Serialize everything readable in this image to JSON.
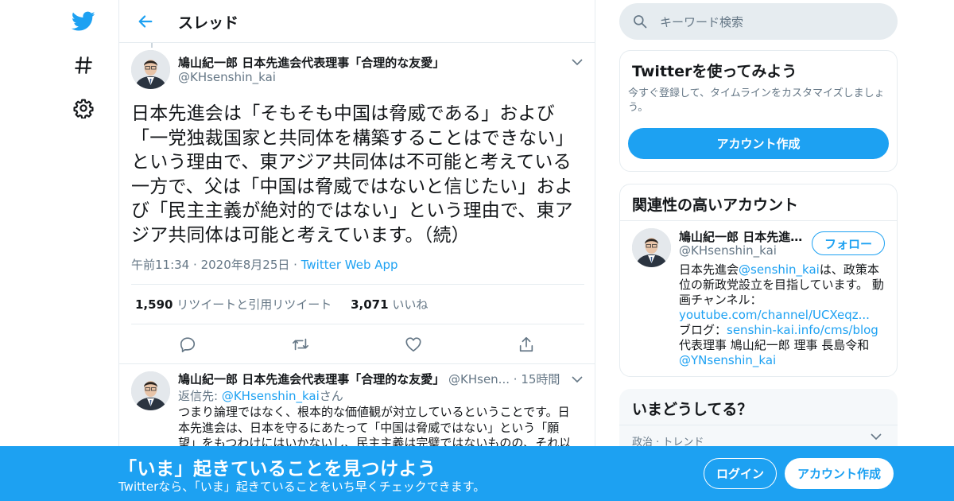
{
  "colors": {
    "accent": "#1da1f2",
    "text": "#14171a",
    "muted": "#657786",
    "border": "#e6ecf0"
  },
  "nav": {
    "icons": [
      "twitter-logo",
      "hashtag-icon",
      "gear-icon"
    ]
  },
  "header": {
    "title": "スレッド"
  },
  "tweet": {
    "name": "鳩山紀一郎 日本先進会代表理事「合理的な友愛」",
    "handle": "@KHsenshin_kai",
    "text": "日本先進会は「そもそも中国は脅威である」および「一党独裁国家と共同体を構築することはできない」という理由で、東アジア共同体は不可能と考えている一方で、父は「中国は脅威ではないと信じたい」および「民主主義が絶対的ではない」という理由で、東アジア共同体は可能と考えています。（続）",
    "time": "午前11:34",
    "date": "2020年8月25日",
    "dot": "·",
    "app": "Twitter Web App",
    "retweets": "1,590",
    "retweets_label": "リツイートと引用リツイート",
    "likes": "3,071",
    "likes_label": "いいね"
  },
  "reply": {
    "name": "鳩山紀一郎 日本先進会代表理事「合理的な友愛」",
    "handle": "@KHsen...",
    "time": "15時間",
    "reply_prefix": "返信先: ",
    "reply_handle": "@KHsenshin_kai",
    "reply_suffix": "さん",
    "text": "つまり論理ではなく、根本的な価値観が対立しているということです。日本先進会は、日本を守るにあたって「中国は脅威ではない」という「願望」をもつわけにはいかないし、民主主義は完璧ではないものの、それ以"
  },
  "search": {
    "placeholder": "キーワード検索"
  },
  "try_card": {
    "title": "Twitterを使ってみよう",
    "subtitle": "今すぐ登録して、タイムラインをカスタマイズしましょう。",
    "button": "アカウント作成"
  },
  "related_card": {
    "title": "関連性の高いアカウント",
    "name": "鳩山紀一郎 日本先進会代表理事「合理的な友愛」",
    "handle": "@KHsenshin_kai",
    "follow": "フォロー",
    "bio_1": "日本先進会",
    "bio_link1": "@senshin_kai",
    "bio_2": "は、政策本位の新政党設立を目指しています。 動画チャンネル：",
    "bio_link2": "youtube.com/channel/UCXeqz...",
    "bio_3": "ブログ：",
    "bio_link3": "senshin-kai.info/cms/blog",
    "bio_4": " 代表理事 鳩山紀一郎 理事 長島令和",
    "bio_link4": "@YNsenshin_kai"
  },
  "trends_card": {
    "title": "いまどうしてる？",
    "trend": "政治 · トレンド"
  },
  "banner": {
    "title": "「いま」起きていることを見つけよう",
    "subtitle": "Twitterなら、「いま」起きていることをいち早くチェックできます。",
    "login": "ログイン",
    "signup": "アカウント作成"
  }
}
